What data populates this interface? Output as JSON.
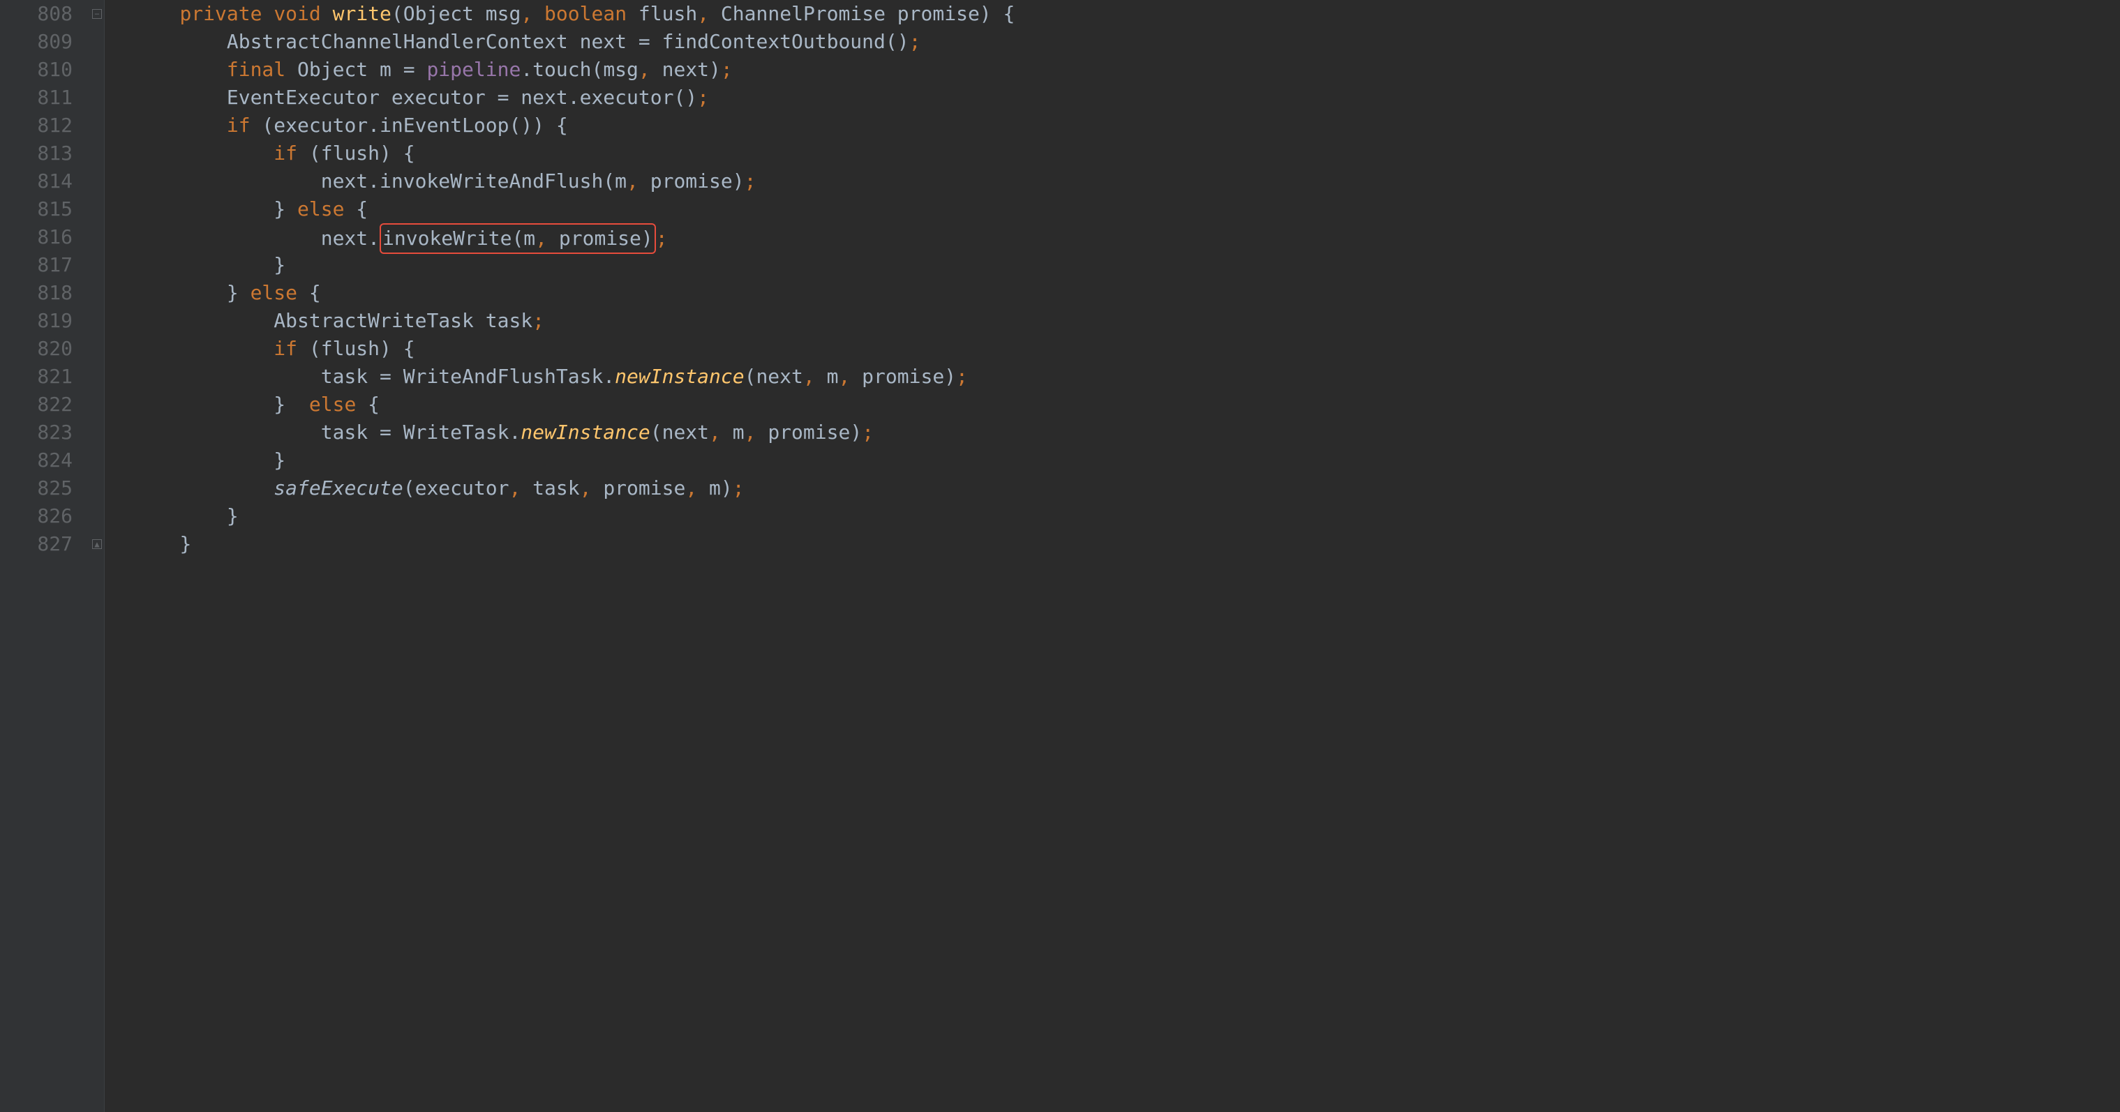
{
  "lines": {
    "start": 808,
    "end": 827
  },
  "fold_markers": [
    {
      "line": 808,
      "glyph": "−"
    },
    {
      "line": 827,
      "glyph": "▲"
    }
  ],
  "highlight": {
    "line": 816,
    "text": "invokeWrite(m, promise)"
  },
  "code": {
    "l808": {
      "kw1": "private",
      "kw2": "void",
      "m": "write",
      "p": "(Object msg",
      "c1": ",",
      "kw3": " boolean",
      "p2": " flush",
      "c2": ",",
      "p3": " ChannelPromise promise) {"
    },
    "l809": {
      "t": "AbstractChannelHandlerContext next = findContextOutbound()",
      "semi": ";"
    },
    "l810": {
      "kw": "final",
      "t1": " Object m = ",
      "f": "pipeline",
      "t2": ".touch(msg",
      "c": ",",
      "t3": " next)",
      "semi": ";"
    },
    "l811": {
      "t": "EventExecutor executor = next.executor()",
      "semi": ";"
    },
    "l812": {
      "kw": "if",
      "t": " (executor.inEventLoop()) {"
    },
    "l813": {
      "kw": "if",
      "t": " (flush) {"
    },
    "l814": {
      "t1": "next.invokeWriteAndFlush(m",
      "c": ",",
      "t2": " promise)",
      "semi": ";"
    },
    "l815": {
      "t1": "} ",
      "kw": "else",
      "t2": " {"
    },
    "l816": {
      "t1": "next.",
      "inside": {
        "m": "invokeWrite(m",
        "c": ",",
        "t": " promise)"
      },
      "semi": ";"
    },
    "l817": {
      "t": "}"
    },
    "l818": {
      "t1": "} ",
      "kw": "else",
      "t2": " {"
    },
    "l819": {
      "t": "AbstractWriteTask task",
      "semi": ";"
    },
    "l820": {
      "kw": "if",
      "t": " (flush) {"
    },
    "l821": {
      "t1": "task = WriteAndFlushTask.",
      "m": "newInstance",
      "t2": "(next",
      "c1": ",",
      "t3": " m",
      "c2": ",",
      "t4": " promise)",
      "semi": ";"
    },
    "l822": {
      "t1": "}  ",
      "kw": "else",
      "t2": " {"
    },
    "l823": {
      "t1": "task = WriteTask.",
      "m": "newInstance",
      "t2": "(next",
      "c1": ",",
      "t3": " m",
      "c2": ",",
      "t4": " promise)",
      "semi": ";"
    },
    "l824": {
      "t": "}"
    },
    "l825": {
      "m": "safeExecute",
      "t1": "(executor",
      "c1": ",",
      "t2": " task",
      "c2": ",",
      "t3": " promise",
      "c3": ",",
      "t4": " m)",
      "semi": ";"
    },
    "l826": {
      "t": "}"
    },
    "l827": {
      "t": "}"
    }
  }
}
